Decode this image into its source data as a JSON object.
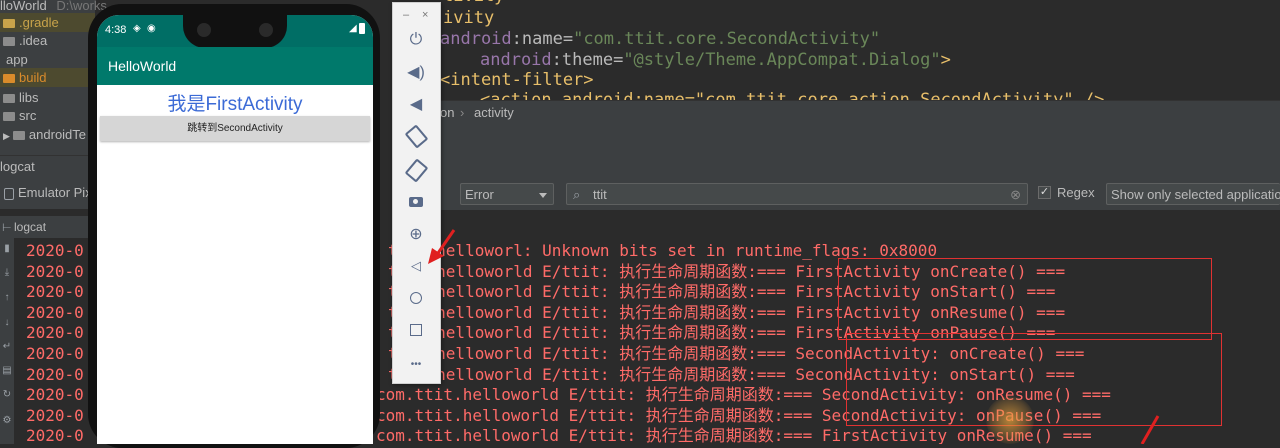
{
  "project": {
    "root_label": "lloWorld",
    "root_path": "D:\\works",
    "items": [
      {
        "label": ".gradle",
        "color": "#c8a34a"
      },
      {
        "label": ".idea",
        "color": "#8c8c8c"
      },
      {
        "label": "app",
        "color": "#8c8c8c"
      },
      {
        "label": "build",
        "color": "#d98b2b"
      },
      {
        "label": "libs",
        "color": "#8c8c8c"
      },
      {
        "label": "src",
        "color": "#8c8c8c"
      },
      {
        "label": "androidTe",
        "color": "#8c8c8c"
      }
    ]
  },
  "editor": {
    "line1": "tivity",
    "line2": "ivity",
    "line3_ns": "android",
    "line3_attr": ":name=",
    "line3_val": "\"com.ttit.core.SecondActivity\"",
    "line4_ns": "android",
    "line4_attr": ":theme=",
    "line4_val": "\"@style/Theme.AppCompat.Dialog\"",
    "line4_end": ">",
    "line5": "<intent-filter>",
    "line6": "<action android:name=\"com.ttit.core.action.SecondActivity\" />"
  },
  "breadcrumb": {
    "part1": "on",
    "sep": "›",
    "part2": "activity"
  },
  "logcat": {
    "panel_title": "logcat",
    "device_label": "Emulator Pix",
    "tab_label": "logcat",
    "level": "Error",
    "search_value": "ttit",
    "regex_label": "Regex",
    "regex_checked": true,
    "filter_option": "Show only selected application",
    "lines": [
      {
        "prefix": "2020-0",
        "text": "ttit.helloworl: Unknown bits set in runtime_flags: 0x8000"
      },
      {
        "prefix": "2020-0",
        "text": "ttit.helloworld E/ttit: 执行生命周期函数:=== FirstActivity onCreate() ==="
      },
      {
        "prefix": "2020-0",
        "text": "ttit.helloworld E/ttit: 执行生命周期函数:=== FirstActivity onStart() ==="
      },
      {
        "prefix": "2020-0",
        "text": "ttit.helloworld E/ttit: 执行生命周期函数:=== FirstActivity onResume() ==="
      },
      {
        "prefix": "2020-0",
        "text": "ttit.helloworld E/ttit: 执行生命周期函数:=== FirstActivity onPause() ==="
      },
      {
        "prefix": "2020-0",
        "text": "ttit.helloworld E/ttit: 执行生命周期函数:=== SecondActivity: onCreate() ==="
      },
      {
        "prefix": "2020-0",
        "text": "ttit.helloworld E/ttit: 执行生命周期函数:=== SecondActivity: onStart() ==="
      },
      {
        "prefix": "2020-0",
        "text": "com.ttit.helloworld E/ttit: 执行生命周期函数:=== SecondActivity: onResume() ==="
      },
      {
        "prefix": "2020-0",
        "text": "com.ttit.helloworld E/ttit: 执行生命周期函数:=== SecondActivity: onPause() ==="
      },
      {
        "prefix": "2020-0",
        "text": "com.ttit.helloworld E/ttit: 执行生命周期函数:=== FirstActivity onResume() ==="
      }
    ]
  },
  "emulator": {
    "time": "4:38",
    "app_title": "HelloWorld",
    "text_view": "我是FirstActivity",
    "button_label": "跳转到SecondActivity",
    "minimize": "–",
    "close": "×",
    "more": "•••"
  },
  "colors": {
    "log_error": "#ff6b68",
    "highlight_box": "#e03232",
    "app_bar": "#00796b",
    "text_view": "#3c6bd6"
  }
}
